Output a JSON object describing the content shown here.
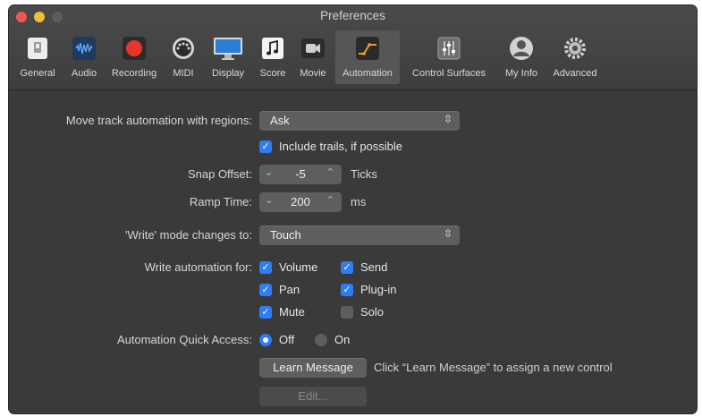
{
  "window": {
    "title": "Preferences"
  },
  "toolbar": {
    "tabs": [
      {
        "label": "General",
        "icon": "general-icon"
      },
      {
        "label": "Audio",
        "icon": "audio-waveform-icon"
      },
      {
        "label": "Recording",
        "icon": "record-icon"
      },
      {
        "label": "MIDI",
        "icon": "midi-connector-icon"
      },
      {
        "label": "Display",
        "icon": "display-icon"
      },
      {
        "label": "Score",
        "icon": "music-note-icon"
      },
      {
        "label": "Movie",
        "icon": "movie-camera-icon"
      },
      {
        "label": "Automation",
        "icon": "automation-curve-icon",
        "active": true
      },
      {
        "label": "Control Surfaces",
        "icon": "faders-icon"
      },
      {
        "label": "My Info",
        "icon": "user-icon"
      },
      {
        "label": "Advanced",
        "icon": "advanced-gears-icon"
      }
    ]
  },
  "automation": {
    "move_label": "Move track automation with regions:",
    "move_value": "Ask",
    "include_trails": "Include trails, if possible",
    "snap_label": "Snap Offset:",
    "snap_value": "-5",
    "snap_unit": "Ticks",
    "ramp_label": "Ramp Time:",
    "ramp_value": "200",
    "ramp_unit": "ms",
    "write_mode_label": "'Write' mode changes to:",
    "write_mode_value": "Touch",
    "write_for_label": "Write automation for:",
    "write_for": {
      "volume": "Volume",
      "send": "Send",
      "pan": "Pan",
      "plugin": "Plug-in",
      "mute": "Mute",
      "solo": "Solo"
    },
    "quick_access_label": "Automation Quick Access:",
    "quick_off": "Off",
    "quick_on": "On",
    "learn_button": "Learn Message",
    "learn_hint": "Click “Learn Message” to assign a new control",
    "edit_button": "Edit..."
  },
  "colors": {
    "accent": "#2e7cf6",
    "background": "#3a3a3a"
  }
}
